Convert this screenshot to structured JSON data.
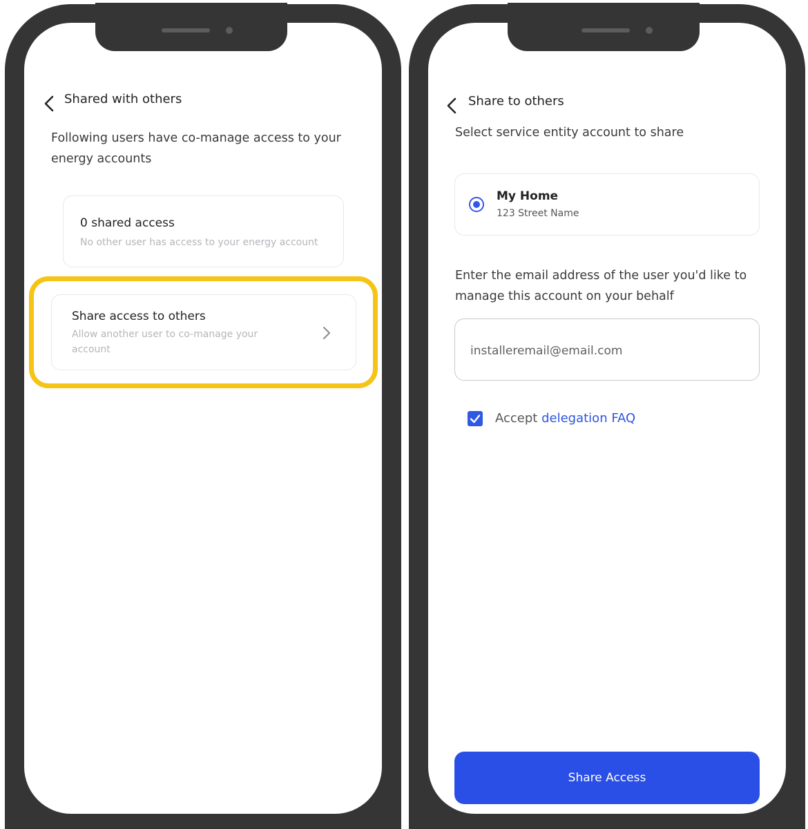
{
  "left_screen": {
    "header": {
      "title": "Shared with others"
    },
    "intro_text": "Following users have co-manage access to your energy accounts",
    "shared_card": {
      "title": "0 shared access",
      "subtitle": "No other user has access to your energy account"
    },
    "share_card": {
      "title": "Share access to others",
      "subtitle": "Allow another user to co-manage your account"
    },
    "highlight_color": "#f5c416"
  },
  "right_screen": {
    "header": {
      "title": "Share to others"
    },
    "select_prompt": "Select service entity account to share",
    "account_option": {
      "name": "My Home",
      "address": "123 Street Name",
      "selected": true
    },
    "email_prompt": "Enter the email address of the user you'd like to manage this account on your behalf",
    "email_input": {
      "value": "installeremail@email.com"
    },
    "accept": {
      "checked": true,
      "prefix": "Accept",
      "link_text": "delegation FAQ"
    },
    "submit_button": {
      "label": "Share Access"
    },
    "accent_color": "#2a4fe6"
  },
  "icons": {
    "back": "chevron-left-icon",
    "forward": "chevron-right-icon",
    "checkmark": "checkmark-icon"
  }
}
